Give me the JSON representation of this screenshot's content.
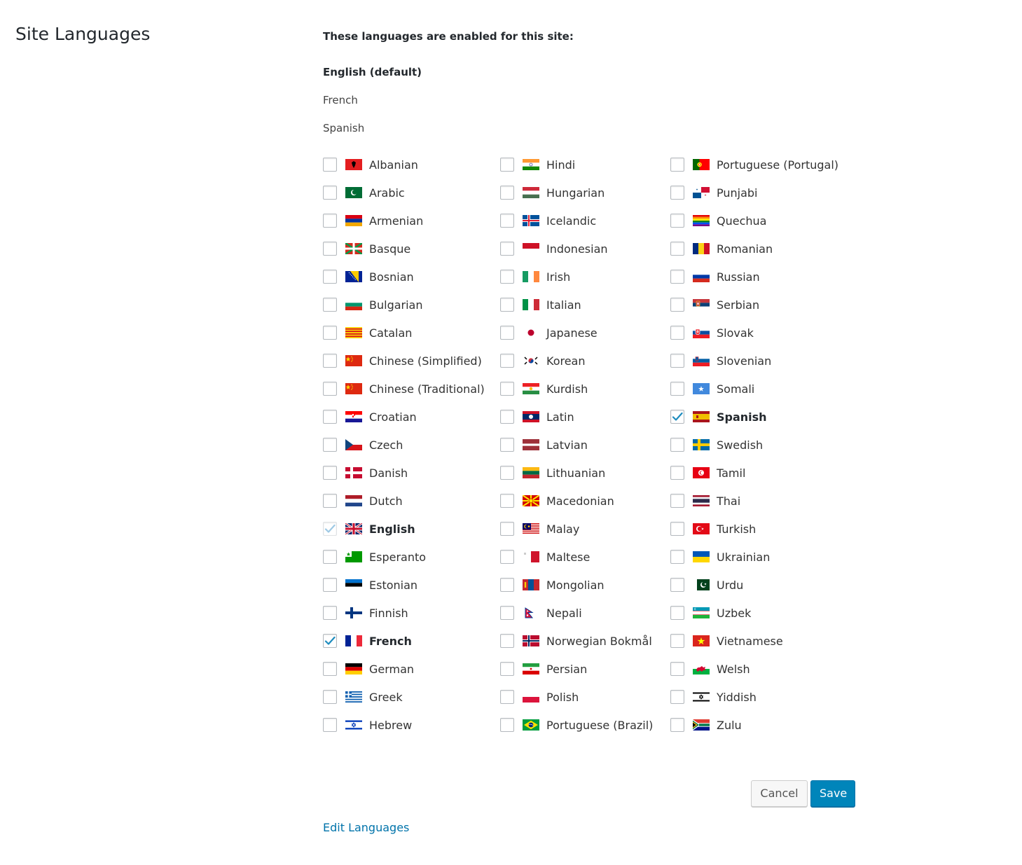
{
  "page": {
    "title": "Site Languages"
  },
  "enabled": {
    "intro": "These languages are enabled for this site:",
    "items": [
      "English (default)",
      "French",
      "Spanish"
    ]
  },
  "languages": {
    "col1": [
      {
        "name": "Albanian",
        "flag": "albania"
      },
      {
        "name": "Arabic",
        "flag": "arab-league"
      },
      {
        "name": "Armenian",
        "flag": "armenia"
      },
      {
        "name": "Basque",
        "flag": "basque"
      },
      {
        "name": "Bosnian",
        "flag": "bosnia"
      },
      {
        "name": "Bulgarian",
        "flag": "bulgaria"
      },
      {
        "name": "Catalan",
        "flag": "catalonia"
      },
      {
        "name": "Chinese (Simplified)",
        "flag": "china"
      },
      {
        "name": "Chinese (Traditional)",
        "flag": "china"
      },
      {
        "name": "Croatian",
        "flag": "croatia"
      },
      {
        "name": "Czech",
        "flag": "czech"
      },
      {
        "name": "Danish",
        "flag": "denmark"
      },
      {
        "name": "Dutch",
        "flag": "netherlands"
      },
      {
        "name": "English",
        "flag": "uk",
        "checked": true,
        "disabled": true
      },
      {
        "name": "Esperanto",
        "flag": "esperanto"
      },
      {
        "name": "Estonian",
        "flag": "estonia"
      },
      {
        "name": "Finnish",
        "flag": "finland"
      },
      {
        "name": "French",
        "flag": "france",
        "checked": true
      },
      {
        "name": "German",
        "flag": "germany"
      },
      {
        "name": "Greek",
        "flag": "greece"
      },
      {
        "name": "Hebrew",
        "flag": "israel"
      }
    ],
    "col2": [
      {
        "name": "Hindi",
        "flag": "india"
      },
      {
        "name": "Hungarian",
        "flag": "hungary"
      },
      {
        "name": "Icelandic",
        "flag": "iceland"
      },
      {
        "name": "Indonesian",
        "flag": "indonesia"
      },
      {
        "name": "Irish",
        "flag": "ireland"
      },
      {
        "name": "Italian",
        "flag": "italy"
      },
      {
        "name": "Japanese",
        "flag": "japan"
      },
      {
        "name": "Korean",
        "flag": "south-korea"
      },
      {
        "name": "Kurdish",
        "flag": "kurdistan"
      },
      {
        "name": "Latin",
        "flag": "laos"
      },
      {
        "name": "Latvian",
        "flag": "latvia"
      },
      {
        "name": "Lithuanian",
        "flag": "lithuania"
      },
      {
        "name": "Macedonian",
        "flag": "macedonia"
      },
      {
        "name": "Malay",
        "flag": "malaysia"
      },
      {
        "name": "Maltese",
        "flag": "malta"
      },
      {
        "name": "Mongolian",
        "flag": "mongolia"
      },
      {
        "name": "Nepali",
        "flag": "nepal"
      },
      {
        "name": "Norwegian Bokmål",
        "flag": "norway"
      },
      {
        "name": "Persian",
        "flag": "iran"
      },
      {
        "name": "Polish",
        "flag": "poland"
      },
      {
        "name": "Portuguese (Brazil)",
        "flag": "brazil"
      }
    ],
    "col3": [
      {
        "name": "Portuguese (Portugal)",
        "flag": "portugal"
      },
      {
        "name": "Punjabi",
        "flag": "panama"
      },
      {
        "name": "Quechua",
        "flag": "rainbow"
      },
      {
        "name": "Romanian",
        "flag": "romania"
      },
      {
        "name": "Russian",
        "flag": "russia"
      },
      {
        "name": "Serbian",
        "flag": "serbia"
      },
      {
        "name": "Slovak",
        "flag": "slovakia"
      },
      {
        "name": "Slovenian",
        "flag": "slovenia"
      },
      {
        "name": "Somali",
        "flag": "somalia"
      },
      {
        "name": "Spanish",
        "flag": "spain",
        "checked": true
      },
      {
        "name": "Swedish",
        "flag": "sweden"
      },
      {
        "name": "Tamil",
        "flag": "tunisia"
      },
      {
        "name": "Thai",
        "flag": "thailand"
      },
      {
        "name": "Turkish",
        "flag": "turkey"
      },
      {
        "name": "Ukrainian",
        "flag": "ukraine"
      },
      {
        "name": "Urdu",
        "flag": "pakistan"
      },
      {
        "name": "Uzbek",
        "flag": "uzbekistan"
      },
      {
        "name": "Vietnamese",
        "flag": "vietnam"
      },
      {
        "name": "Welsh",
        "flag": "wales"
      },
      {
        "name": "Yiddish",
        "flag": "yiddish"
      },
      {
        "name": "Zulu",
        "flag": "south-africa"
      }
    ]
  },
  "actions": {
    "cancel": "Cancel",
    "save": "Save",
    "edit_link": "Edit Languages"
  },
  "colors": {
    "accent": "#0085ba",
    "link": "#0073aa",
    "checkmark": "#1e8cbe"
  }
}
